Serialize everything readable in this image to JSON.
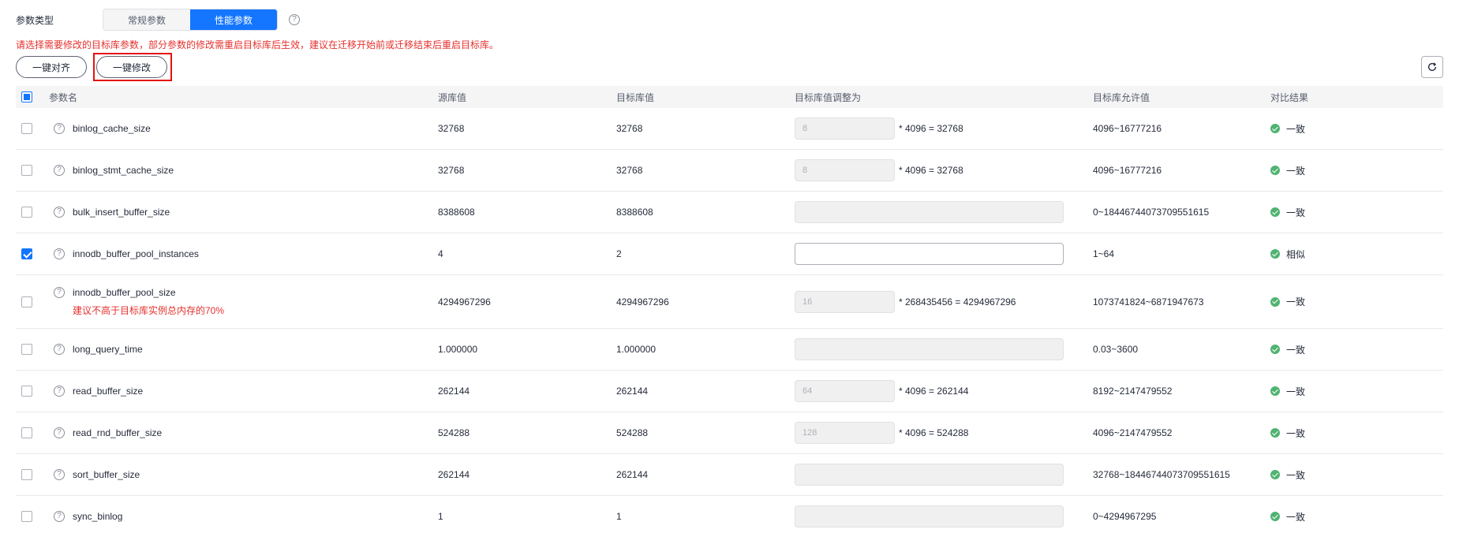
{
  "param_type": {
    "label": "参数类型",
    "tabs": [
      "常规参数",
      "性能参数"
    ],
    "active_tab": "性能参数"
  },
  "notice": "请选择需要修改的目标库参数，部分参数的修改需重启目标库后生效，建议在迁移开始前或迁移结束后重启目标库。",
  "buttons": {
    "align_all": "一键对齐",
    "modify_all": "一键修改"
  },
  "table": {
    "headers": {
      "name": "参数名",
      "source": "源库值",
      "target": "目标库值",
      "adjust": "目标库值调整为",
      "allowed": "目标库允许值",
      "result": "对比结果"
    },
    "rows": [
      {
        "name": "binlog_cache_size",
        "source": "32768",
        "target": "32768",
        "input": "8",
        "formula": "* 4096 = 32768",
        "allowed": "4096~16777216",
        "result": "一致",
        "checked": false
      },
      {
        "name": "binlog_stmt_cache_size",
        "source": "32768",
        "target": "32768",
        "input": "8",
        "formula": "* 4096 = 32768",
        "allowed": "4096~16777216",
        "result": "一致",
        "checked": false
      },
      {
        "name": "bulk_insert_buffer_size",
        "source": "8388608",
        "target": "8388608",
        "input": "",
        "formula": "",
        "allowed": "0~18446744073709551615",
        "result": "一致",
        "checked": false
      },
      {
        "name": "innodb_buffer_pool_instances",
        "source": "4",
        "target": "2",
        "input": "",
        "formula": "",
        "allowed": "1~64",
        "result": "相似",
        "checked": true
      },
      {
        "name": "innodb_buffer_pool_size",
        "warning": "建议不高于目标库实例总内存的70%",
        "source": "4294967296",
        "target": "4294967296",
        "input": "16",
        "formula": "* 268435456 = 4294967296",
        "allowed": "1073741824~6871947673",
        "result": "一致",
        "checked": false
      },
      {
        "name": "long_query_time",
        "source": "1.000000",
        "target": "1.000000",
        "input": "",
        "formula": "",
        "allowed": "0.03~3600",
        "result": "一致",
        "checked": false
      },
      {
        "name": "read_buffer_size",
        "source": "262144",
        "target": "262144",
        "input": "64",
        "formula": "* 4096 = 262144",
        "allowed": "8192~2147479552",
        "result": "一致",
        "checked": false
      },
      {
        "name": "read_rnd_buffer_size",
        "source": "524288",
        "target": "524288",
        "input": "128",
        "formula": "* 4096 = 524288",
        "allowed": "4096~2147479552",
        "result": "一致",
        "checked": false
      },
      {
        "name": "sort_buffer_size",
        "source": "262144",
        "target": "262144",
        "input": "",
        "formula": "",
        "allowed": "32768~18446744073709551615",
        "result": "一致",
        "checked": false
      },
      {
        "name": "sync_binlog",
        "source": "1",
        "target": "1",
        "input": "",
        "formula": "",
        "allowed": "0~4294967295",
        "result": "一致",
        "checked": false
      }
    ]
  },
  "colors": {
    "accent": "#1476ff",
    "warning": "#e5312e",
    "success": "#50b371",
    "highlight_frame": "#e3120b"
  },
  "icons": {
    "help": "question-circle-icon",
    "refresh": "refresh-icon",
    "result_ok": "check-circle-icon"
  }
}
